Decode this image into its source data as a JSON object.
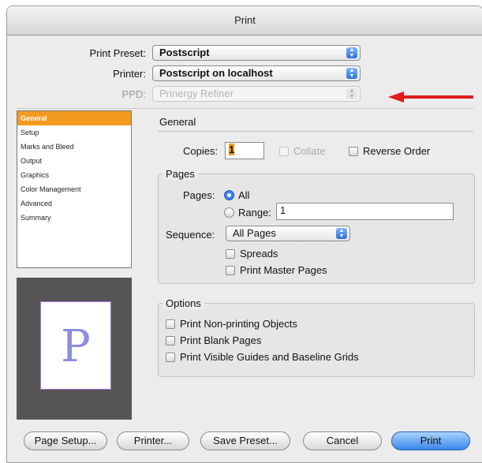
{
  "window": {
    "title": "Print"
  },
  "preset": {
    "print_preset_label": "Print Preset:",
    "print_preset_value": "Postscript",
    "printer_label": "Printer:",
    "printer_value": "Postscript on localhost",
    "ppd_label": "PPD:",
    "ppd_value": "Prinergy Refiner"
  },
  "sidebar": {
    "items": [
      {
        "label": "General"
      },
      {
        "label": "Setup"
      },
      {
        "label": "Marks and Bleed"
      },
      {
        "label": "Output"
      },
      {
        "label": "Graphics"
      },
      {
        "label": "Color Management"
      },
      {
        "label": "Advanced"
      },
      {
        "label": "Summary"
      }
    ],
    "selected": "General"
  },
  "preview": {
    "letter": "P"
  },
  "general": {
    "section_title": "General",
    "copies_label": "Copies:",
    "copies_value": "1",
    "collate_label": "Collate",
    "reverse_order_label": "Reverse Order",
    "pages_group": {
      "title": "Pages",
      "pages_label": "Pages:",
      "all_label": "All",
      "range_label": "Range:",
      "range_value": "1",
      "sequence_label": "Sequence:",
      "sequence_value": "All Pages",
      "spreads_label": "Spreads",
      "print_master_pages_label": "Print Master Pages"
    },
    "options_group": {
      "title": "Options",
      "print_nonprinting_label": "Print Non-printing Objects",
      "print_blank_pages_label": "Print Blank Pages",
      "print_visible_guides_label": "Print Visible Guides and Baseline Grids"
    }
  },
  "buttons": {
    "page_setup": "Page Setup...",
    "printer": "Printer...",
    "save_preset": "Save Preset...",
    "cancel": "Cancel",
    "print": "Print"
  },
  "colors": {
    "accent": "#3b86e8",
    "selection": "#f39b1e",
    "annotation_arrow": "#e01b1b"
  }
}
